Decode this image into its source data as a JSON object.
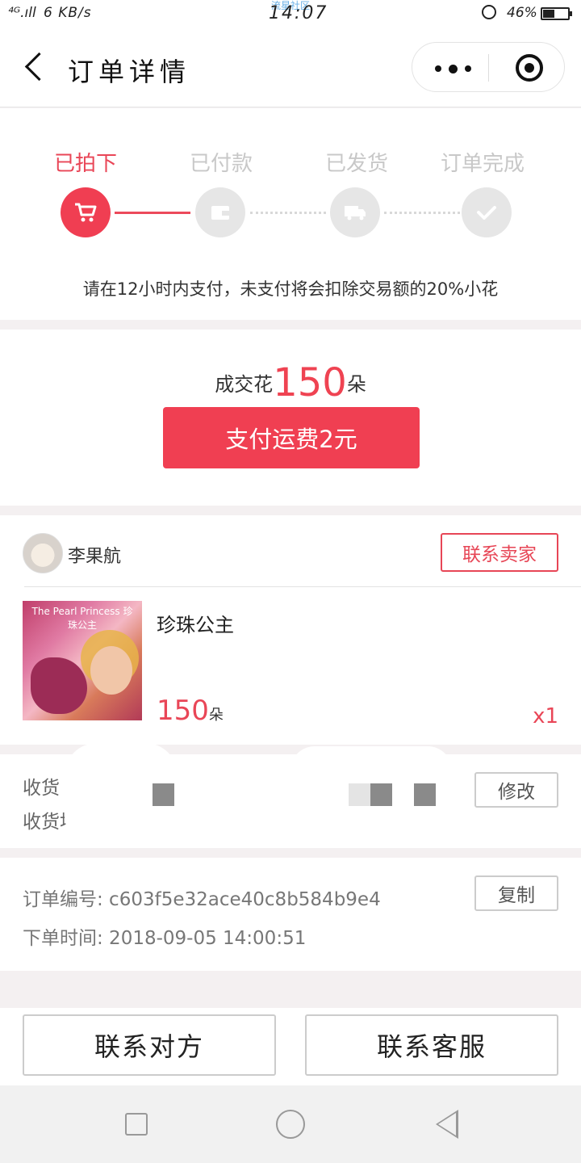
{
  "status_bar": {
    "network": "⁴ᴳ.ıll",
    "speed": "6 KB/s",
    "time": "14:07",
    "watermark": "流星社区",
    "battery_pct": "46%",
    "battery_level": 0.46
  },
  "nav": {
    "title": "订单详情"
  },
  "progress": {
    "steps": [
      {
        "label": "已拍下",
        "icon": "cart-icon",
        "active": true
      },
      {
        "label": "已付款",
        "icon": "wallet-icon",
        "active": false
      },
      {
        "label": "已发货",
        "icon": "truck-icon",
        "active": false
      },
      {
        "label": "订单完成",
        "icon": "check-icon",
        "active": false
      }
    ],
    "notice": "请在12小时内支付，未支付将会扣除交易额的20%小花"
  },
  "deal": {
    "prefix": "成交花",
    "amount": "150",
    "unit": "朵",
    "pay_button": "支付运费2元"
  },
  "seller": {
    "name": "李果航",
    "contact_button": "联系卖家"
  },
  "product": {
    "image_caption": "The Pearl Princess 珍珠公主",
    "title": "珍珠公主",
    "price": "150",
    "price_unit": "朵",
    "quantity": "x1"
  },
  "address": {
    "line1": "收货",
    "line2": "收货地址",
    "edit_button": "修改"
  },
  "order": {
    "number_label": "订单编号: c603f5e32ace40c8b584b9e4",
    "time_label": "下单时间: 2018-09-05 14:00:51",
    "copy_button": "复制"
  },
  "footer": {
    "contact_other": "联系对方",
    "contact_service": "联系客服"
  },
  "colors": {
    "accent": "#f03f52",
    "inactive": "#e6e6e6",
    "background": "#f4f0f1"
  }
}
